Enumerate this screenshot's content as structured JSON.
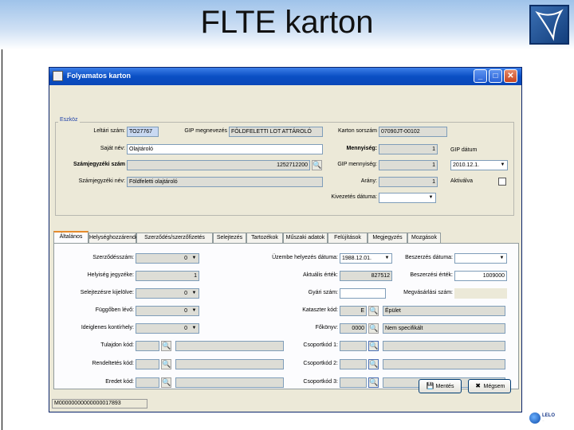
{
  "slide": {
    "title": "FLTE karton"
  },
  "window": {
    "title": "Folyamatos karton",
    "min": "_",
    "max": "□",
    "close": "✕"
  },
  "group": {
    "legend": "Eszköz",
    "leltari_szam_label": "Leltári szám:",
    "leltari_szam": "TO27767",
    "gip_label": "GIP megnevezés",
    "gip": "FÖLDFELETTI LOT ATTÁROLÓ",
    "karton_label": "Karton sorszám",
    "karton": "07090JT-00102",
    "sajat_nev_label": "Saját név:",
    "sajat_nev": "Olajtároló",
    "mennyiseg_label": "Mennyiség:",
    "mennyiseg": "1",
    "szamlegyzek_label": "Számjegyzéki szám",
    "szamlegyzek": "1252712200",
    "gip_mennyiseg_label": "GIP mennyiség:",
    "gip_mennyiseg": "1",
    "szamlegyzek_nev_label": "Számjegyzéki név:",
    "szamlegyzek_nev": "Földfeletti olajtároló",
    "arany_label": "Arány:",
    "arany": "1",
    "kivezetes_label": "Kivezetés dátuma:",
    "kivezetes": "",
    "gip_datum_label": "GIP dátum",
    "gip_datum": "2010.12.1.",
    "aktivalva_label": "Aktiválva"
  },
  "tabs": [
    "Általános",
    "Helységhozzárendelés",
    "Szerződés/szerzőfizetés",
    "Selejtezés",
    "Tartozékok",
    "Műszaki adatok",
    "Felújítások",
    "Megjegyzés",
    "Mozgások"
  ],
  "general": {
    "szerzodes_label": "Szerződésszám:",
    "szerzodes": "0",
    "helyiseg_label": "Helyiség jegyzéke:",
    "helyiseg": "1",
    "selejtezes_label": "Selejtezésre kijelölve:",
    "selejtezes": "0",
    "fuggoben_label": "Függőben lévő:",
    "fuggoben": "0",
    "ideiglenes_label": "Ideiglenes kontírhely:",
    "ideiglenes": "0",
    "tulajdon_label": "Tulajdon kód:",
    "rendeltetes_label": "Rendeltetés kód:",
    "eredet_label": "Eredet kód:",
    "uzembe_label": "Üzembe helyezés dátuma:",
    "uzembe": "1988.12.01.",
    "aktualis_label": "Aktuális érték:",
    "aktualis": "827512",
    "gyari_label": "Gyári szám:",
    "gyari": "",
    "kataszter_label": "Kataszter kód:",
    "kataszter": "E",
    "kataszter_nev": "Épület",
    "fokonyv_label": "Főkönyv:",
    "fokonyv": "0000",
    "fokonyv_nev": "Nem specifikált",
    "csop1_label": "Csoportkód 1:",
    "csop2_label": "Csoportkód 2:",
    "csop3_label": "Csoportkód 3:",
    "beszerzes_datum_label": "Beszerzés dátuma:",
    "beszerzes_datum": "",
    "beszerzes_ertek_label": "Beszerzési érték:",
    "beszerzes_ertek": "1009000",
    "megvasarlas_label": "Megvásárlási szám:"
  },
  "buttons": {
    "save": "Mentés",
    "cancel": "Mégsem"
  },
  "status": {
    "id": "M00000000000000017893"
  },
  "footer": {
    "brand": "LELO",
    "sub": "..."
  },
  "colors": {
    "titlebar": "#0a4fc4",
    "tab_accent": "#e68b2c"
  }
}
